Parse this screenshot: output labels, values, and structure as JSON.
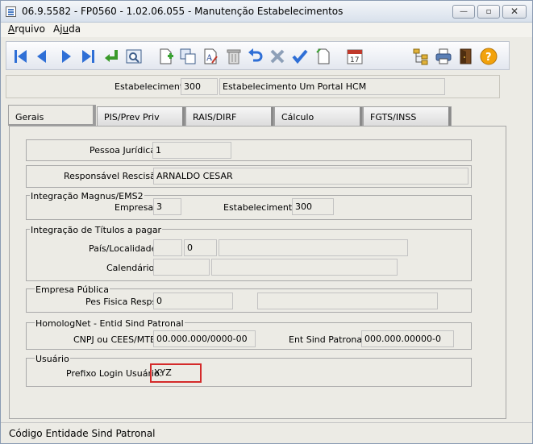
{
  "window": {
    "title": "06.9.5582 - FP0560 - 1.02.06.055 - Manutenção Estabelecimentos",
    "minimize": "—",
    "maximize": "▫",
    "close": "✕"
  },
  "menu": {
    "arquivo": "Arquivo",
    "ajuda": "Ajuda"
  },
  "toolbar": {
    "icons": [
      "first-icon",
      "previous-icon",
      "next-icon",
      "last-icon",
      "goto-icon",
      "search-icon",
      "new-icon",
      "copy-icon",
      "edit-icon",
      "delete-icon",
      "undo-icon",
      "cancel-icon",
      "confirm-icon",
      "blank-page-icon",
      "calendar-icon",
      "tree-icon",
      "print-icon",
      "exit-icon",
      "help-icon"
    ],
    "calendar_day": "17",
    "help_glyph": "?"
  },
  "header": {
    "estabelecimento_label": "Estabelecimento:",
    "estabelecimento_code": "300",
    "estabelecimento_name": "Estabelecimento Um Portal HCM"
  },
  "tabs": [
    {
      "label": "Gerais",
      "active": true
    },
    {
      "label": "PIS/Prev Priv",
      "active": false
    },
    {
      "label": "RAIS/DIRF",
      "active": false
    },
    {
      "label": "Cálculo",
      "active": false
    },
    {
      "label": "FGTS/INSS",
      "active": false
    }
  ],
  "gerais": {
    "pessoa_juridica_label": "Pessoa Jurídica:",
    "pessoa_juridica_value": "1",
    "responsavel_label": "Responsável Rescisão:",
    "responsavel_value": "ARNALDO CESAR",
    "integracao_magnus": {
      "title": "Integração Magnus/EMS2",
      "empresa_label": "Empresa:",
      "empresa_value": "3",
      "estabelecimento_label": "Estabelecimento:",
      "estabelecimento_value": "300"
    },
    "integracao_titulos": {
      "title": "Integração de Títulos a pagar",
      "pais_label": "País/Localidade:",
      "pais_value": "",
      "localidade_value": "0",
      "localidade_desc": "",
      "calendario_label": "Calendário:",
      "calendario_value": "",
      "calendario_extra": "",
      "calendario_desc": ""
    },
    "empresa_publica": {
      "title": "Empresa Pública",
      "pes_fisica_label": "Pes Fisica Resps:",
      "pes_fisica_value": "0",
      "pes_fisica_desc": ""
    },
    "homolognet": {
      "title": "HomologNet - Entid Sind Patronal",
      "cnpj_label": "CNPJ ou CEES/MTE:",
      "cnpj_value": "00.000.000/0000-00",
      "ent_sind_label": "Ent Sind Patronal:",
      "ent_sind_value": "000.000.00000-0"
    },
    "usuario": {
      "title": "Usuário",
      "prefixo_label": "Prefixo Login Usuário:",
      "prefixo_value": "XYZ"
    }
  },
  "status": {
    "text": "Código Entidade Sind Patronal"
  },
  "colors": {
    "nav_blue": "#2f6fd6",
    "highlight": "#d42a2a",
    "help_orange": "#f2a20c"
  }
}
